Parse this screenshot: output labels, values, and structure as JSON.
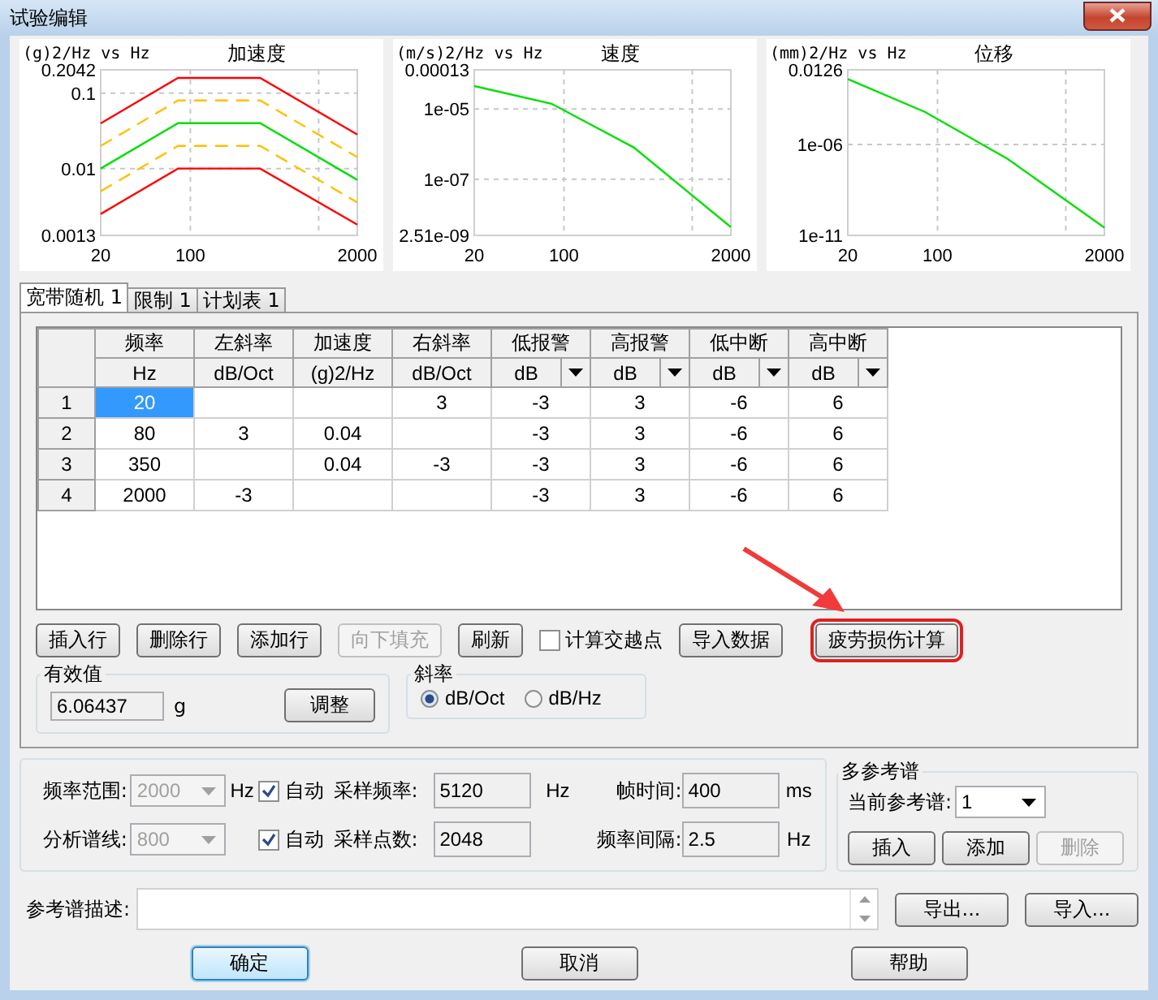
{
  "window": {
    "title": "试验编辑"
  },
  "charts": [
    {
      "kind": "acceleration",
      "title": "加速度",
      "unit_label": "(g)2/Hz vs Hz",
      "yticks": [
        "0.2042",
        "0.1",
        "0.01",
        "0.0013"
      ],
      "xticks": [
        "20",
        "100",
        "2000"
      ]
    },
    {
      "kind": "velocity",
      "title": "速度",
      "unit_label": "(m/s)2/Hz vs Hz",
      "yticks": [
        "0.00013",
        "1e-05",
        "1e-07",
        "2.51e-09"
      ],
      "xticks": [
        "20",
        "100",
        "2000"
      ]
    },
    {
      "kind": "displacement",
      "title": "位移",
      "unit_label": "(mm)2/Hz vs Hz",
      "yticks": [
        "0.0126",
        "1e-06",
        "1e-11"
      ],
      "xticks": [
        "20",
        "100",
        "2000"
      ]
    }
  ],
  "tabs": [
    {
      "label": "宽带随机 1",
      "selected": true
    },
    {
      "label": "限制 1",
      "selected": false
    },
    {
      "label": "计划表 1",
      "selected": false
    }
  ],
  "table": {
    "columns": [
      {
        "name": "频率",
        "unit": "Hz",
        "dropdown": false
      },
      {
        "name": "左斜率",
        "unit": "dB/Oct",
        "dropdown": false
      },
      {
        "name": "加速度",
        "unit": "(g)2/Hz",
        "dropdown": false
      },
      {
        "name": "右斜率",
        "unit": "dB/Oct",
        "dropdown": false
      },
      {
        "name": "低报警",
        "unit": "dB",
        "dropdown": true
      },
      {
        "name": "高报警",
        "unit": "dB",
        "dropdown": true
      },
      {
        "name": "低中断",
        "unit": "dB",
        "dropdown": true
      },
      {
        "name": "高中断",
        "unit": "dB",
        "dropdown": true
      }
    ],
    "rows": [
      {
        "number": "1",
        "selected": true,
        "cells": [
          "20",
          null,
          null,
          "3",
          "-3",
          "3",
          "-6",
          "6"
        ]
      },
      {
        "number": "2",
        "selected": false,
        "cells": [
          "80",
          "3",
          "0.04",
          null,
          "-3",
          "3",
          "-6",
          "6"
        ]
      },
      {
        "number": "3",
        "selected": false,
        "cells": [
          "350",
          null,
          "0.04",
          "-3",
          "-3",
          "3",
          "-6",
          "6"
        ]
      },
      {
        "number": "4",
        "selected": false,
        "cells": [
          "2000",
          "-3",
          null,
          null,
          "-3",
          "3",
          "-6",
          "6"
        ]
      }
    ]
  },
  "actions": [
    {
      "kind": "button",
      "label": "插入行",
      "disabled": false
    },
    {
      "kind": "button",
      "label": "删除行",
      "disabled": false
    },
    {
      "kind": "button",
      "label": "添加行",
      "disabled": false
    },
    {
      "kind": "button",
      "label": "向下填充",
      "disabled": true
    },
    {
      "kind": "button",
      "label": "刷新",
      "disabled": false
    },
    {
      "kind": "checkbox",
      "label": "计算交越点",
      "checked": false
    },
    {
      "kind": "button",
      "label": "导入数据",
      "disabled": false
    },
    {
      "kind": "highlighted",
      "label": "疲劳损伤计算",
      "disabled": false
    }
  ],
  "rms": {
    "title": "有效值",
    "value": "6.06437",
    "unit": "g",
    "button": "调整"
  },
  "slope": {
    "title": "斜率",
    "options": [
      {
        "label": "dB/Oct",
        "selected": true
      },
      {
        "label": "dB/Hz",
        "selected": false
      }
    ]
  },
  "settings": [
    {
      "label": "频率范围:",
      "value": "2000",
      "unit": "Hz",
      "auto": {
        "label": "自动",
        "checked": true
      },
      "field1_label": "采样频率:",
      "field1": "5120",
      "field1_unit": "Hz",
      "field2_label": "帧时间:",
      "field2": "400",
      "field2_unit": "ms"
    },
    {
      "label": "分析谱线:",
      "value": "800",
      "auto": {
        "label": "自动",
        "checked": true
      },
      "field1_label": "采样点数:",
      "field1": "2048",
      "field2_label": "频率间隔:",
      "field2": "2.5",
      "field2_unit": "Hz"
    }
  ],
  "multi_ref": {
    "title": "多参考谱",
    "label": "当前参考谱:",
    "value": "1",
    "buttons": [
      {
        "label": "插入",
        "disabled": false
      },
      {
        "label": "添加",
        "disabled": false
      },
      {
        "label": "删除",
        "disabled": true
      }
    ]
  },
  "description": {
    "label": "参考谱描述:",
    "buttons": [
      "导出...",
      "导入..."
    ]
  },
  "footer": [
    {
      "label": "确定",
      "default": true
    },
    {
      "label": "取消",
      "default": false
    },
    {
      "label": "帮助",
      "default": false
    }
  ]
}
